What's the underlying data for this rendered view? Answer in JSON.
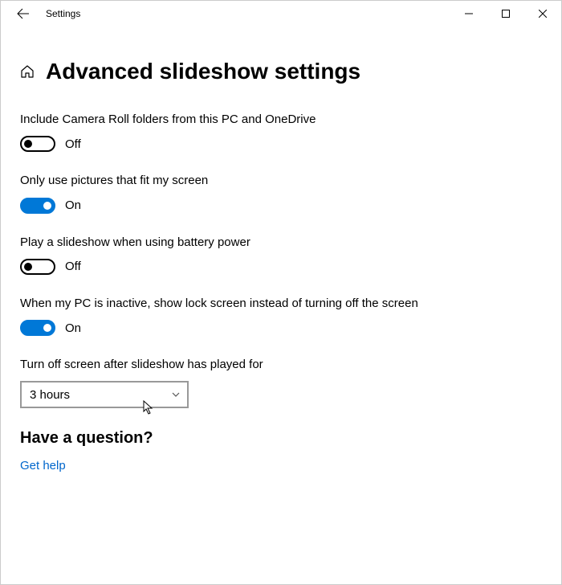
{
  "window": {
    "title": "Settings"
  },
  "page": {
    "title": "Advanced slideshow settings"
  },
  "settings": {
    "cameraRoll": {
      "label": "Include Camera Roll folders from this PC and OneDrive",
      "state": "Off"
    },
    "fitScreen": {
      "label": "Only use pictures that fit my screen",
      "state": "On"
    },
    "batteryPower": {
      "label": "Play a slideshow when using battery power",
      "state": "Off"
    },
    "inactiveLock": {
      "label": "When my PC is inactive, show lock screen instead of turning off the screen",
      "state": "On"
    },
    "turnOffAfter": {
      "label": "Turn off screen after slideshow has played for",
      "selected": "3 hours"
    }
  },
  "help": {
    "title": "Have a question?",
    "link": "Get help"
  }
}
